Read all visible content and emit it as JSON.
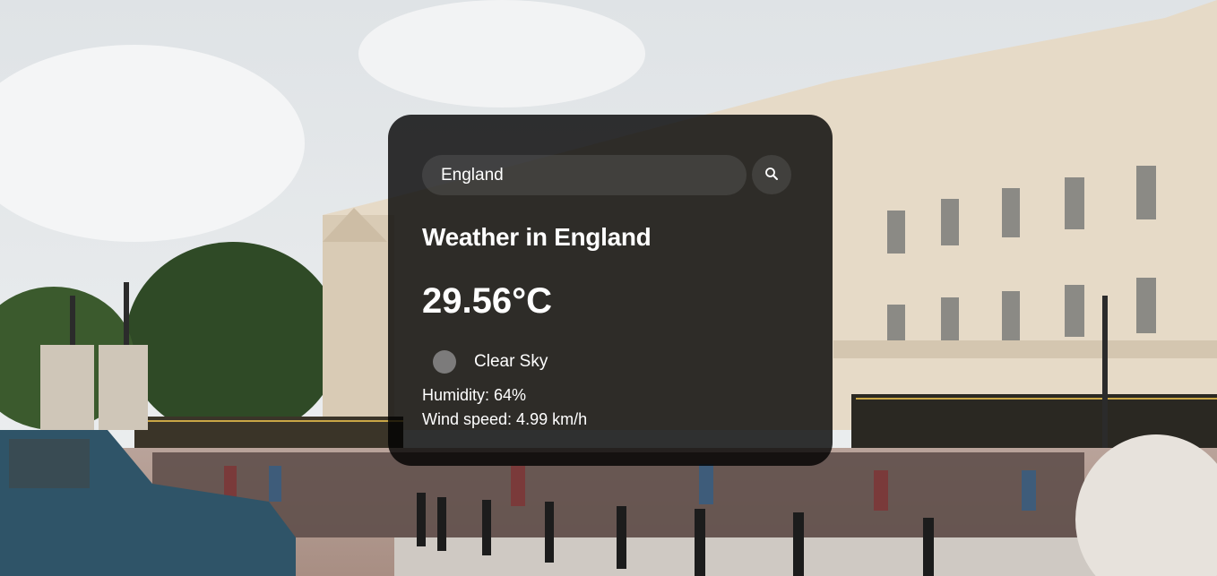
{
  "search": {
    "value": "England",
    "icon": "search-icon"
  },
  "weather": {
    "title": "Weather in England",
    "temperature": "29.56°C",
    "condition": "Clear Sky",
    "condition_icon": "weather-condition-icon",
    "humidity": "Humidity: 64%",
    "wind": "Wind speed: 4.99 km/h"
  },
  "colors": {
    "card_background": "#000000",
    "text": "#ffffff",
    "sky": "#d9dee2",
    "building": "#e8dccb"
  }
}
